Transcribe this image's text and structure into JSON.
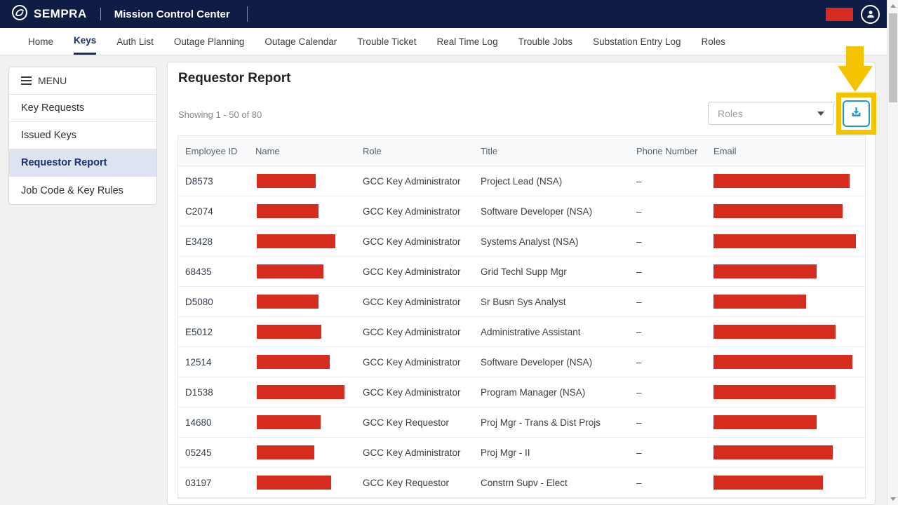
{
  "header": {
    "brand": "SEMPRA",
    "app_title": "Mission Control Center"
  },
  "nav": {
    "tabs": [
      {
        "label": "Home",
        "active": false
      },
      {
        "label": "Keys",
        "active": true
      },
      {
        "label": "Auth List",
        "active": false
      },
      {
        "label": "Outage Planning",
        "active": false
      },
      {
        "label": "Outage Calendar",
        "active": false
      },
      {
        "label": "Trouble Ticket",
        "active": false
      },
      {
        "label": "Real Time Log",
        "active": false
      },
      {
        "label": "Trouble Jobs",
        "active": false
      },
      {
        "label": "Substation Entry Log",
        "active": false
      },
      {
        "label": "Roles",
        "active": false
      }
    ]
  },
  "sidebar": {
    "menu_label": "MENU",
    "items": [
      {
        "label": "Key Requests",
        "selected": false
      },
      {
        "label": "Issued Keys",
        "selected": false
      },
      {
        "label": "Requestor Report",
        "selected": true
      },
      {
        "label": "Job Code & Key Rules",
        "selected": false
      }
    ]
  },
  "main": {
    "title": "Requestor Report",
    "showing_text": "Showing 1 - 50 of 80",
    "roles_placeholder": "Roles",
    "table": {
      "columns": [
        "Employee ID",
        "Name",
        "Role",
        "Title",
        "Phone Number",
        "Email"
      ],
      "rows": [
        {
          "employee_id": "D8573",
          "role": "GCC Key Administrator",
          "title": "Project Lead (NSA)",
          "phone": "–",
          "name_redaction_w": 84,
          "email_redaction_w": 194
        },
        {
          "employee_id": "C2074",
          "role": "GCC Key Administrator",
          "title": "Software Developer (NSA)",
          "phone": "–",
          "name_redaction_w": 88,
          "email_redaction_w": 184
        },
        {
          "employee_id": "E3428",
          "role": "GCC Key Administrator",
          "title": "Systems Analyst (NSA)",
          "phone": "–",
          "name_redaction_w": 112,
          "email_redaction_w": 203
        },
        {
          "employee_id": "68435",
          "role": "GCC Key Administrator",
          "title": "Grid Techl Supp Mgr",
          "phone": "–",
          "name_redaction_w": 95,
          "email_redaction_w": 147
        },
        {
          "employee_id": "D5080",
          "role": "GCC Key Administrator",
          "title": "Sr Busn Sys Analyst",
          "phone": "–",
          "name_redaction_w": 88,
          "email_redaction_w": 132
        },
        {
          "employee_id": "E5012",
          "role": "GCC Key Administrator",
          "title": "Administrative Assistant",
          "phone": "–",
          "name_redaction_w": 92,
          "email_redaction_w": 174
        },
        {
          "employee_id": "12514",
          "role": "GCC Key Administrator",
          "title": "Software Developer (NSA)",
          "phone": "–",
          "name_redaction_w": 104,
          "email_redaction_w": 198
        },
        {
          "employee_id": "D1538",
          "role": "GCC Key Administrator",
          "title": "Program Manager (NSA)",
          "phone": "–",
          "name_redaction_w": 125,
          "email_redaction_w": 174
        },
        {
          "employee_id": "14680",
          "role": "GCC Key Requestor",
          "title": "Proj Mgr - Trans & Dist Projs",
          "phone": "–",
          "name_redaction_w": 91,
          "email_redaction_w": 147
        },
        {
          "employee_id": "05245",
          "role": "GCC Key Administrator",
          "title": "Proj Mgr - II",
          "phone": "–",
          "name_redaction_w": 82,
          "email_redaction_w": 170
        },
        {
          "employee_id": "03197",
          "role": "GCC Key Requestor",
          "title": "Constrn Supv - Elect",
          "phone": "–",
          "name_redaction_w": 106,
          "email_redaction_w": 156
        }
      ]
    }
  },
  "icons": {
    "logo": "sempra-logo-icon",
    "avatar": "user-avatar-icon",
    "download": "download-icon",
    "menu": "hamburger-icon",
    "dropdown": "chevron-down-icon"
  },
  "colors": {
    "header_navy": "#0f1c45",
    "active_navy": "#1b2f6b",
    "redaction_red": "#d62b1f",
    "annotation_yellow": "#f3c301",
    "button_blue": "#1e96d2",
    "selected_row_bg": "#dee3f2"
  }
}
